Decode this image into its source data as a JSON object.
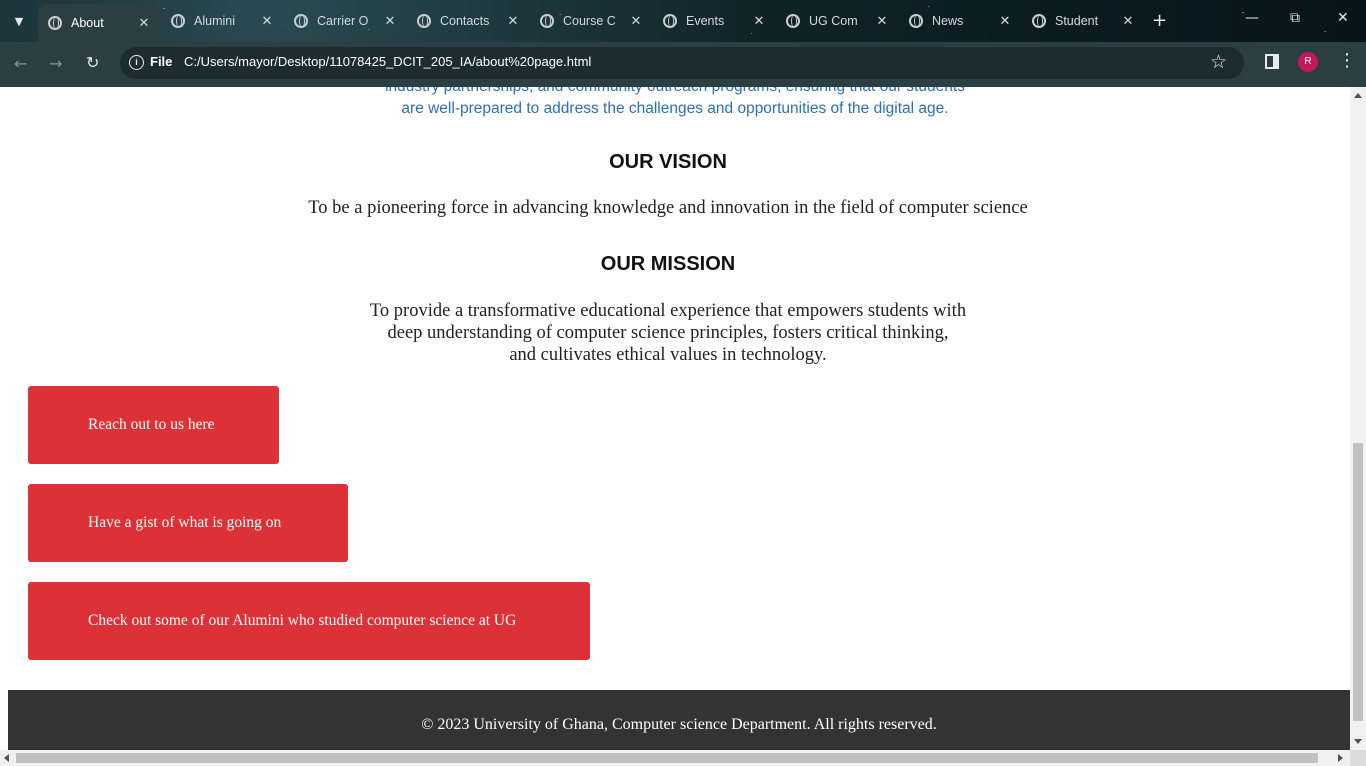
{
  "browser": {
    "tabs": [
      {
        "label": "About",
        "active": true
      },
      {
        "label": "Alumini",
        "active": false
      },
      {
        "label": "Carrier O",
        "active": false
      },
      {
        "label": "Contacts",
        "active": false
      },
      {
        "label": "Course C",
        "active": false
      },
      {
        "label": "Events",
        "active": false
      },
      {
        "label": "UG Com",
        "active": false
      },
      {
        "label": "News",
        "active": false
      },
      {
        "label": "Student",
        "active": false
      }
    ],
    "new_tab_icon": "+",
    "site_chip": "File",
    "url": "C:/Users/mayor/Desktop/11078425_DCIT_205_IA/about%20page.html",
    "profile_initial": "R",
    "profile_color": "#c2185b"
  },
  "page": {
    "intro_line_1": "industry partnerships, and community outreach programs, ensuring that our students",
    "intro_line_2": "are well-prepared to address the challenges and opportunities of the digital age.",
    "vision": {
      "heading": "OUR VISION",
      "text": "To be a pioneering force in advancing knowledge and innovation in the field of computer science"
    },
    "mission": {
      "heading": "OUR MISSION",
      "line_1": "To provide a transformative educational experience that empowers students with",
      "line_2": "deep understanding of computer science principles, fosters critical thinking,",
      "line_3": "and cultivates ethical values in technology."
    },
    "buttons": {
      "contact": "Reach out to us here",
      "news": "Have a gist of what is going on",
      "alumni": "Check out some of our Alumini who studied computer science at UG"
    },
    "footer": "© 2023 University of Ghana, Computer science Department. All rights reserved."
  },
  "colors": {
    "button_red": "#dc3237",
    "footer_bg": "#333333",
    "intro_blue": "#2e6fae",
    "toolbar_bg": "#2b3e42"
  }
}
